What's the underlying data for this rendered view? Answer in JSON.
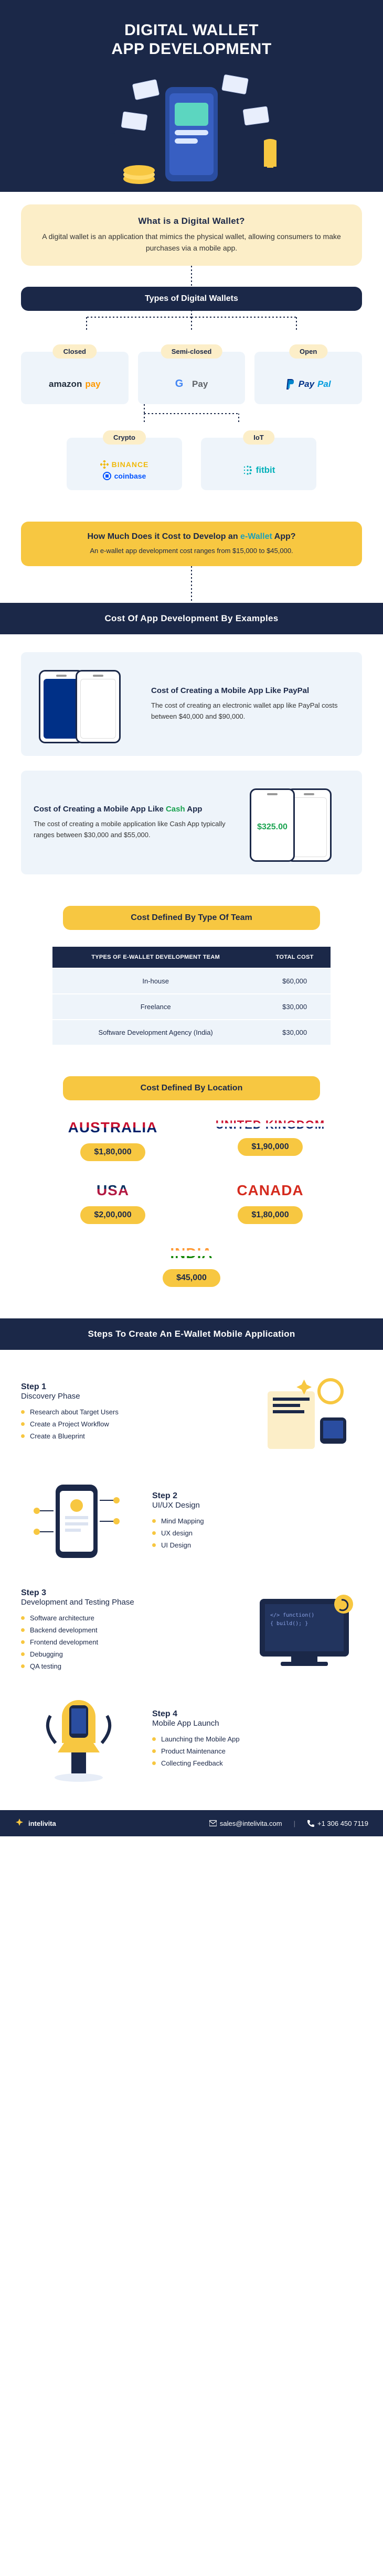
{
  "hero": {
    "title": "DIGITAL WALLET\nAPP DEVELOPMENT"
  },
  "intro": {
    "heading": "What is a Digital Wallet?",
    "body": "A digital wallet is an application that mimics the physical wallet, allowing consumers to make purchases via a mobile app."
  },
  "types": {
    "heading": "Types of Digital Wallets",
    "cards": [
      {
        "tag": "Closed",
        "brands": [
          "amazon pay"
        ]
      },
      {
        "tag": "Semi-closed",
        "brands": [
          "G Pay"
        ]
      },
      {
        "tag": "Open",
        "brands": [
          "PayPal"
        ]
      },
      {
        "tag": "Crypto",
        "brands": [
          "BINANCE",
          "coinbase"
        ]
      },
      {
        "tag": "IoT",
        "brands": [
          "fitbit"
        ]
      }
    ]
  },
  "cost_q": {
    "question_pre": "How Much Does it Cost to Develop an ",
    "question_em": "e-Wallet",
    "question_post": " App?",
    "answer": "An e-wallet app development cost ranges from $15,000 to $45,000."
  },
  "examples": {
    "heading": "Cost Of App Development By Examples",
    "paypal": {
      "title": "Cost of Creating a Mobile App Like PayPal",
      "body": "The cost of creating an electronic wallet app like PayPal costs between $40,000 and $90,000."
    },
    "cashapp": {
      "title_pre": "Cost of Creating a Mobile App Like ",
      "title_em": "Cash",
      "title_post": " App",
      "body": "The cost of creating a mobile application like Cash App typically ranges between $30,000 and $55,000."
    }
  },
  "team_table": {
    "heading": "Cost Defined By Type Of Team",
    "headers": [
      "TYPES OF E-WALLET DEVELOPMENT TEAM",
      "TOTAL COST"
    ],
    "rows": [
      {
        "type": "In-house",
        "cost": "$60,000"
      },
      {
        "type": "Freelance",
        "cost": "$30,000"
      },
      {
        "type": "Software Development Agency (India)",
        "cost": "$30,000"
      }
    ]
  },
  "location": {
    "heading": "Cost Defined By Location",
    "items": [
      {
        "name": "AUSTRALIA",
        "cls": "au",
        "price": "$1,80,000"
      },
      {
        "name": "UNITED KINGDOM",
        "cls": "uk",
        "price": "$1,90,000"
      },
      {
        "name": "USA",
        "cls": "us",
        "price": "$2,00,000"
      },
      {
        "name": "CANADA",
        "cls": "ca",
        "price": "$1,80,000"
      },
      {
        "name": "INDIA",
        "cls": "in",
        "price": "$45,000"
      }
    ]
  },
  "steps": {
    "heading": "Steps To Create An E-Wallet Mobile Application",
    "list": [
      {
        "kicker": "Step 1",
        "title": "Discovery Phase",
        "bullets": [
          "Research about Target Users",
          "Create a Project Workflow",
          "Create a Blueprint"
        ]
      },
      {
        "kicker": "Step 2",
        "title": "UI/UX Design",
        "bullets": [
          "Mind Mapping",
          "UX design",
          "UI Design"
        ]
      },
      {
        "kicker": "Step 3",
        "title": "Development and Testing Phase",
        "bullets": [
          "Software architecture",
          "Backend development",
          "Frontend development",
          "Debugging",
          "QA testing"
        ]
      },
      {
        "kicker": "Step 4",
        "title": "Mobile App Launch",
        "bullets": [
          "Launching the Mobile App",
          "Product Maintenance",
          "Collecting Feedback"
        ]
      }
    ]
  },
  "footer": {
    "brand": "intelivita",
    "email": "sales@intelivita.com",
    "phone": "+1 306 450 7119"
  }
}
